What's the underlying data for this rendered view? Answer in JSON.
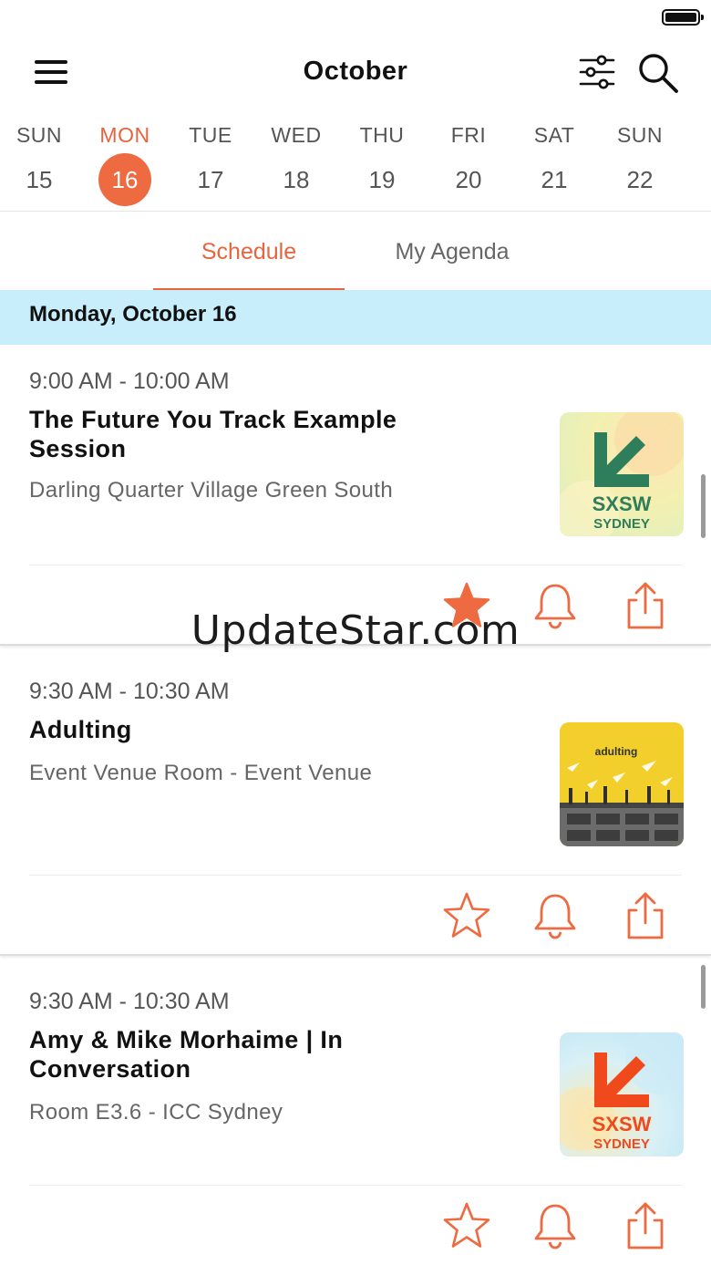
{
  "header": {
    "title": "October"
  },
  "week": [
    {
      "name": "SUN",
      "num": "15",
      "active": false
    },
    {
      "name": "MON",
      "num": "16",
      "active": true
    },
    {
      "name": "TUE",
      "num": "17",
      "active": false
    },
    {
      "name": "WED",
      "num": "18",
      "active": false
    },
    {
      "name": "THU",
      "num": "19",
      "active": false
    },
    {
      "name": "FRI",
      "num": "20",
      "active": false
    },
    {
      "name": "SAT",
      "num": "21",
      "active": false
    },
    {
      "name": "SUN",
      "num": "22",
      "active": false
    }
  ],
  "tabs": [
    {
      "label": "Schedule",
      "active": true
    },
    {
      "label": "My Agenda",
      "active": false
    }
  ],
  "date_header": "Monday, October 16",
  "sessions": [
    {
      "time": "9:00 AM - 10:00 AM",
      "title": "The Future You Track Example Session",
      "venue": "Darling Quarter Village Green South",
      "starred": true,
      "thumb": "sxsw-sydney-green",
      "thumb_text": [
        "SXSW",
        "SYDNEY"
      ]
    },
    {
      "time": "9:30 AM - 10:30 AM",
      "title": "Adulting",
      "venue": "Event Venue Room - Event Venue",
      "starred": false,
      "thumb": "adulting-poster",
      "thumb_text": [
        "adulting"
      ]
    },
    {
      "time": "9:30 AM - 10:30 AM",
      "title": "Amy & Mike Morhaime | In Conversation",
      "venue": "Room E3.6 - ICC Sydney",
      "starred": false,
      "thumb": "sxsw-sydney-orange",
      "thumb_text": [
        "SXSW",
        "SYDNEY"
      ]
    }
  ],
  "watermark": "UpdateStar.com",
  "colors": {
    "accent": "#ee6a40",
    "date_header_bg": "#c9eefb",
    "thumb_green": "#2e7d5b",
    "thumb_orange": "#f04a1c",
    "poster_yellow": "#f2cf2a"
  },
  "icons": [
    "menu-icon",
    "filter-icon",
    "search-icon",
    "star-icon",
    "bell-icon",
    "share-icon"
  ]
}
